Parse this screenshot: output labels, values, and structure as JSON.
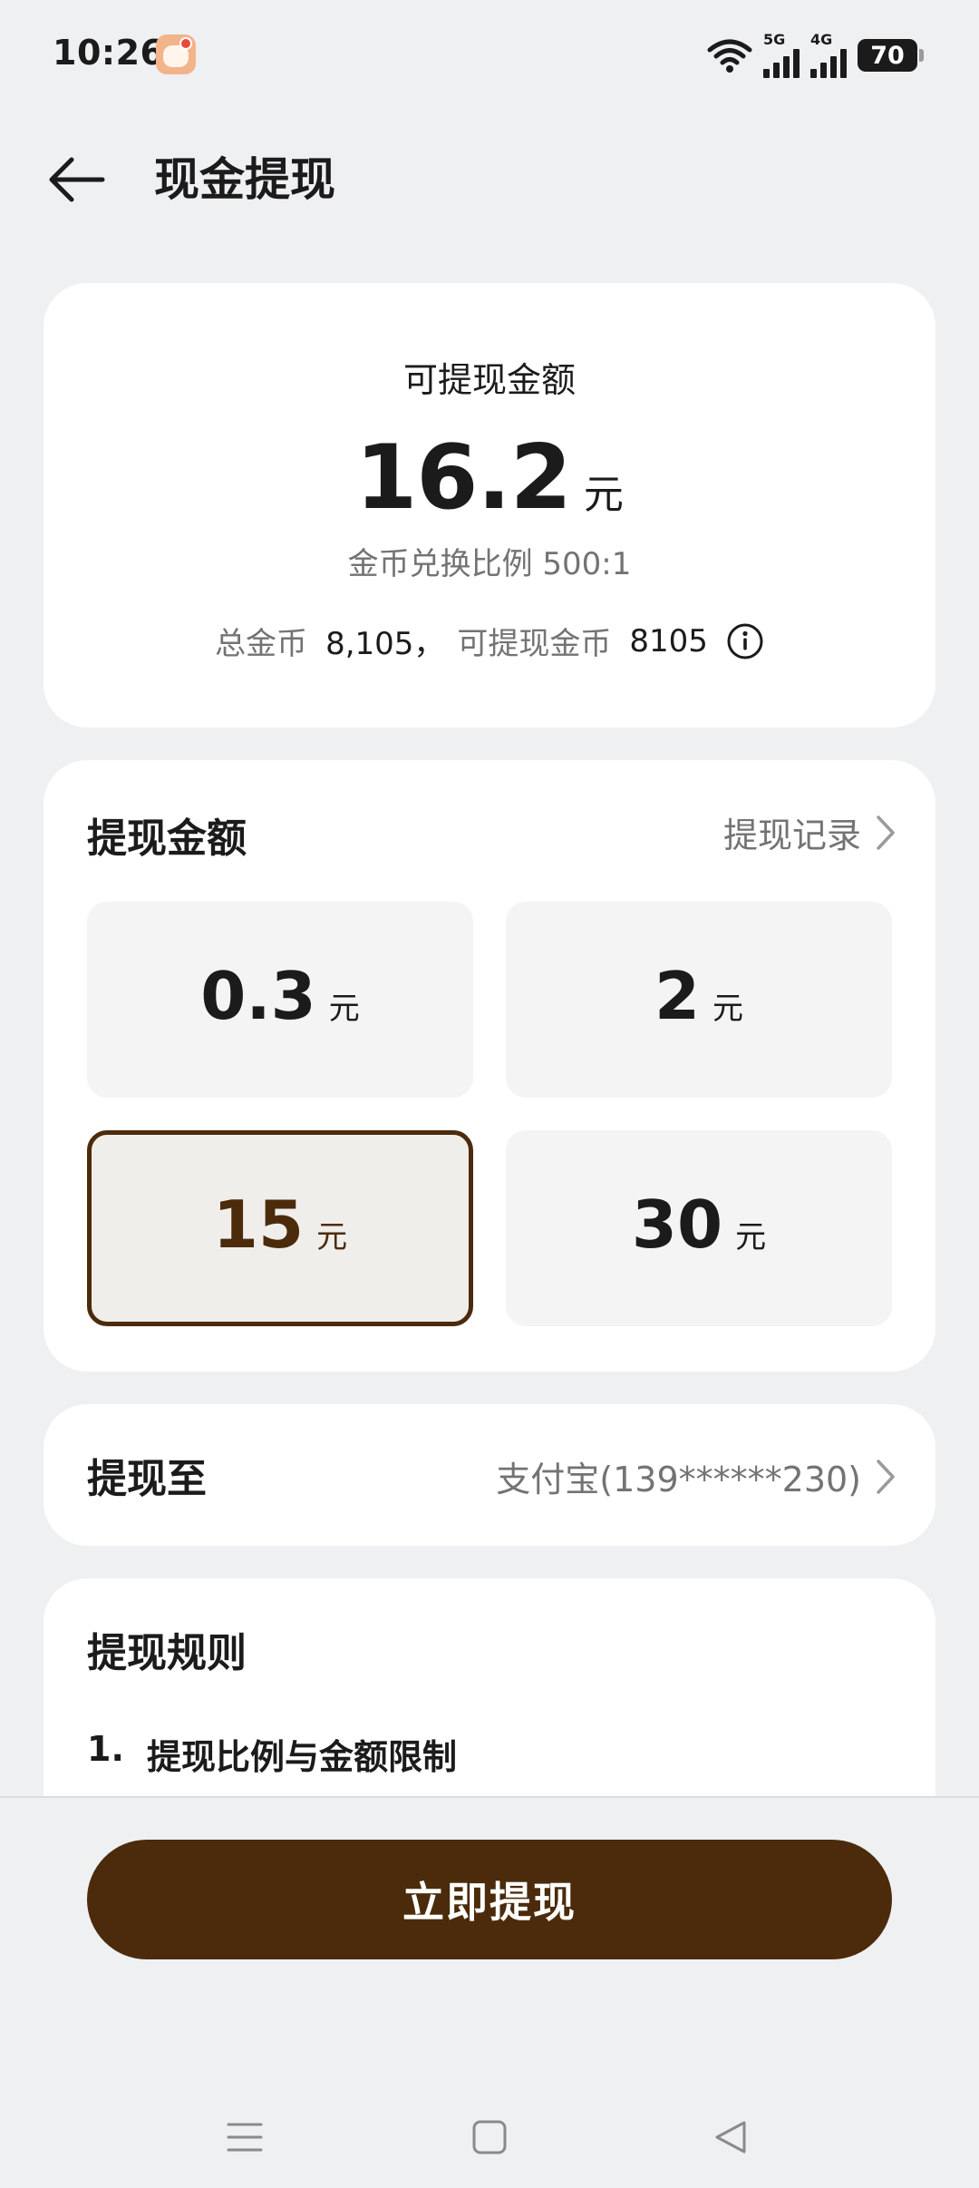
{
  "status_bar": {
    "time": "10:26",
    "signal_1_label": "5G",
    "signal_2_label": "4G",
    "battery": "70",
    "icons": [
      "app-notification-icon",
      "wifi-icon",
      "signal-icon",
      "battery-icon"
    ]
  },
  "header": {
    "title": "现金提现",
    "back_icon": "arrow-left-icon"
  },
  "balance": {
    "label": "可提现金额",
    "amount": "16.2",
    "unit": "元",
    "rate_text": "金币兑换比例 500:1",
    "total_coins_label": "总金币",
    "total_coins_value": "8,105，",
    "withdrawable_coins_label": "可提现金币",
    "withdrawable_coins_value": "8105",
    "info_icon": "info-icon"
  },
  "amount_section": {
    "title": "提现金额",
    "records_link": "提现记录",
    "options": [
      {
        "value": "0.3",
        "unit": "元",
        "selected": false
      },
      {
        "value": "2",
        "unit": "元",
        "selected": false
      },
      {
        "value": "15",
        "unit": "元",
        "selected": true
      },
      {
        "value": "30",
        "unit": "元",
        "selected": false
      }
    ]
  },
  "destination": {
    "title": "提现至",
    "value": "支付宝(139******230)"
  },
  "rules": {
    "title": "提现规则",
    "item_1_index": "1.",
    "item_1_text": "提现比例与金额限制"
  },
  "action": {
    "withdraw_label": "立即提现"
  },
  "colors": {
    "accent": "#4b2b0b",
    "background": "#eff0f2",
    "card": "#ffffff",
    "option_bg": "#f4f4f4",
    "secondary_text": "#737373"
  }
}
